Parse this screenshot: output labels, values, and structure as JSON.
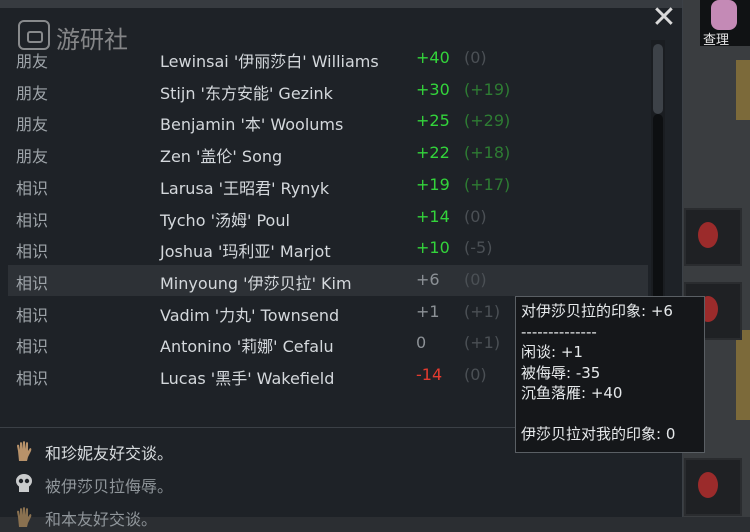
{
  "window": {
    "close_glyph": "✕"
  },
  "watermark": {
    "text": "游研社",
    "icon": "game-controller-icon"
  },
  "background": {
    "character_label": "查理"
  },
  "relations": [
    {
      "relation": "朋友",
      "name": "Lewinsai '伊丽莎白' Williams",
      "opinion": "+40",
      "their_opinion": "(0)"
    },
    {
      "relation": "朋友",
      "name": "Stijn '东方安能' Gezink",
      "opinion": "+30",
      "their_opinion": "(+19)"
    },
    {
      "relation": "朋友",
      "name": "Benjamin '本' Woolums",
      "opinion": "+25",
      "their_opinion": "(+29)"
    },
    {
      "relation": "朋友",
      "name": "Zen '盖伦' Song",
      "opinion": "+22",
      "their_opinion": "(+18)"
    },
    {
      "relation": "相识",
      "name": "Larusa '王昭君' Rynyk",
      "opinion": "+19",
      "their_opinion": "(+17)"
    },
    {
      "relation": "相识",
      "name": "Tycho '汤姆' Poul",
      "opinion": "+14",
      "their_opinion": "(0)"
    },
    {
      "relation": "相识",
      "name": "Joshua '玛利亚' Marjot",
      "opinion": "+10",
      "their_opinion": "(-5)"
    },
    {
      "relation": "相识",
      "name": "Minyoung '伊莎贝拉' Kim",
      "opinion": "+6",
      "their_opinion": "(0)"
    },
    {
      "relation": "相识",
      "name": "Vadim '力丸' Townsend",
      "opinion": "+1",
      "their_opinion": "(+1)"
    },
    {
      "relation": "相识",
      "name": "Antonino '莉娜' Cefalu",
      "opinion": "0",
      "their_opinion": "(+1)"
    },
    {
      "relation": "相识",
      "name": "Lucas '黑手' Wakefield",
      "opinion": "-14",
      "their_opinion": "(0)"
    }
  ],
  "log": [
    {
      "icon": "hand-icon",
      "text": "和珍妮友好交谈。"
    },
    {
      "icon": "skull-icon",
      "text": "被伊莎贝拉侮辱。"
    },
    {
      "icon": "hand-icon",
      "text": "和本友好交谈。"
    }
  ],
  "tooltip": {
    "title": "对伊莎贝拉的印象: +6",
    "separator": "--------------",
    "line1": "闲谈: +1",
    "line2": "被侮辱: -35",
    "line3": "沉鱼落雁: +40",
    "footer": "伊莎贝拉对我的印象: 0"
  },
  "colors": {
    "positive": "#33d43b",
    "negative": "#e33b2f",
    "neutral": "#8c9196",
    "panel_bg": "#1e2227"
  }
}
